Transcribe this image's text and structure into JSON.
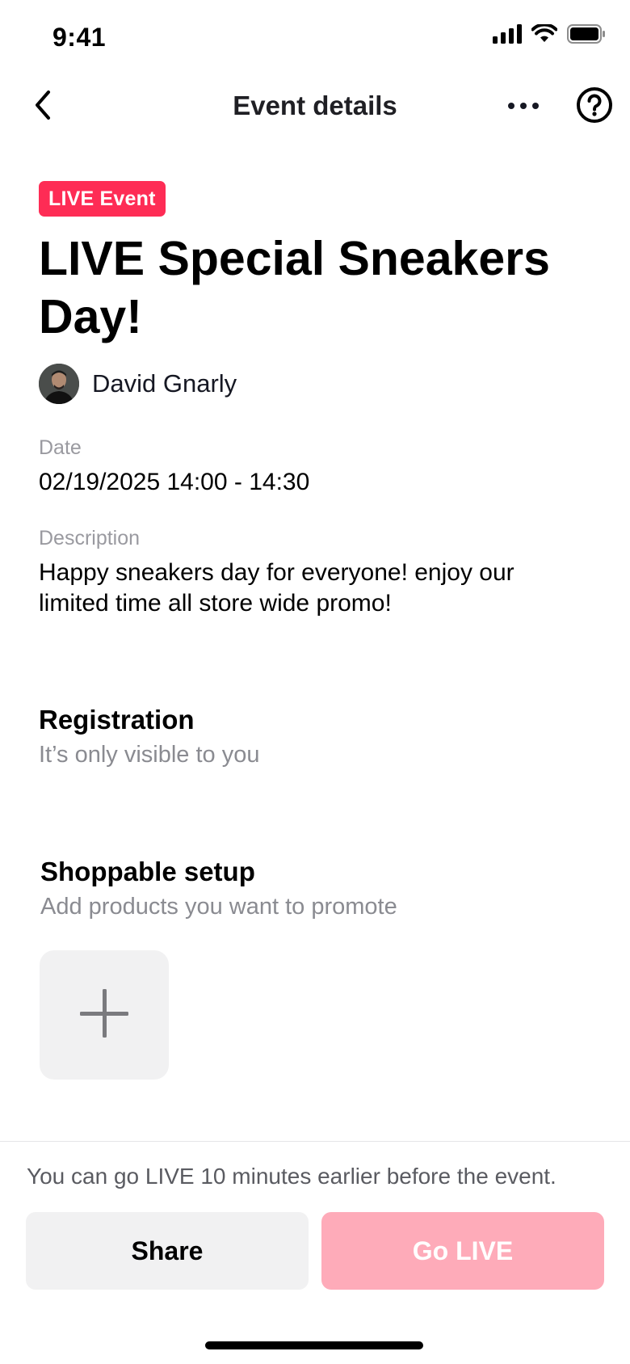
{
  "status_bar": {
    "time": "9:41"
  },
  "nav": {
    "title": "Event details",
    "back_icon": "chevron-left-icon",
    "more_icon": "more-horizontal-icon",
    "help_icon": "question-circle-icon"
  },
  "event": {
    "badge": "LIVE Event",
    "title": "LIVE Special Sneakers Day!",
    "host_name": "David Gnarly",
    "date_label": "Date",
    "date_value": "02/19/2025 14:00 - 14:30",
    "description_label": "Description",
    "description_value": "Happy sneakers day for everyone! enjoy our limited time all store wide promo!"
  },
  "registration": {
    "title": "Registration",
    "subtitle": "It’s only visible to you"
  },
  "shoppable": {
    "title": "Shoppable setup",
    "subtitle": "Add products you want to promote",
    "add_icon": "plus-icon"
  },
  "footer": {
    "note": "You can go LIVE 10 minutes earlier before the event.",
    "share_label": "Share",
    "go_live_label": "Go LIVE"
  },
  "colors": {
    "accent": "#fe2c55",
    "accent_disabled": "#feabb9",
    "secondary_button": "#f1f1f2",
    "muted_text": "#8a8b91"
  }
}
